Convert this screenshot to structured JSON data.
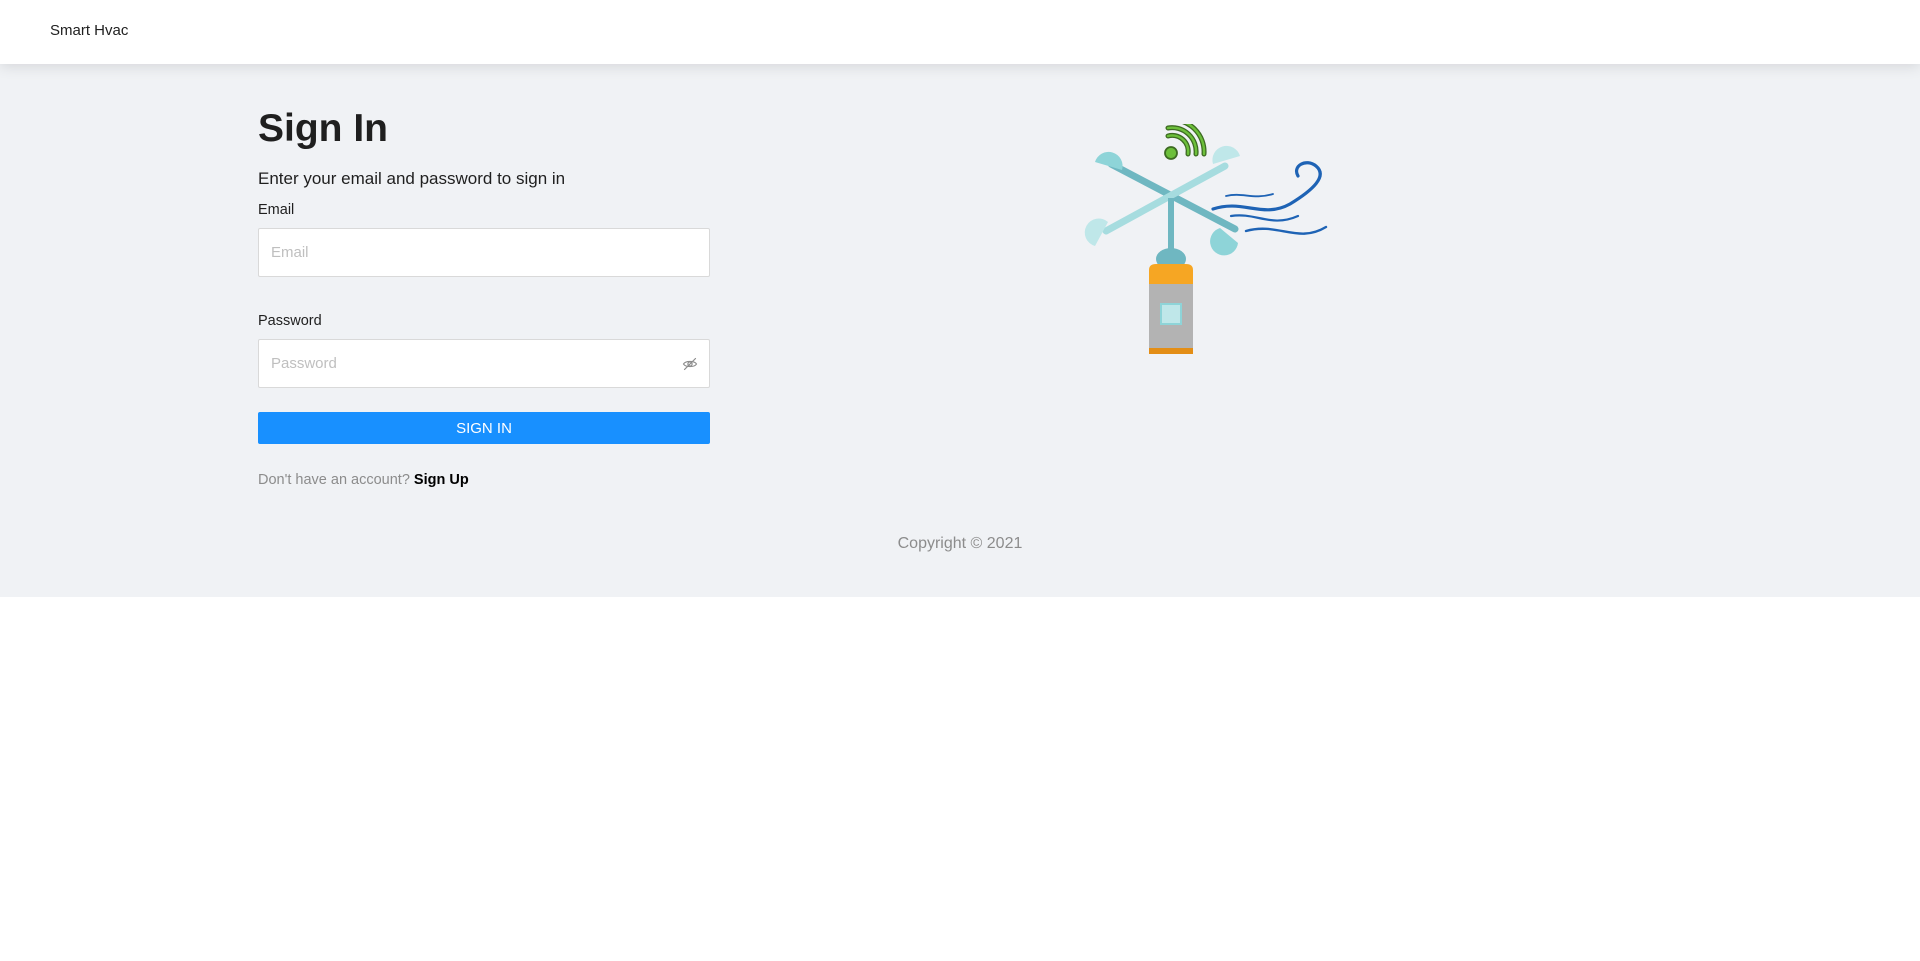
{
  "navbar": {
    "brand": "Smart Hvac"
  },
  "signin": {
    "title": "Sign In",
    "subtitle": "Enter your email and password to sign in",
    "email_label": "Email",
    "email_placeholder": "Email",
    "email_value": "",
    "password_label": "Password",
    "password_placeholder": "Password",
    "password_value": "",
    "password_toggle_icon": "eye-invisible-icon",
    "submit_label": "SIGN IN",
    "signup_prompt": "Don't have an account?",
    "signup_link": "Sign Up"
  },
  "illustration": {
    "icon": "anemometer-wind-sensor-icon"
  },
  "footer": {
    "copyright": "Copyright © 2021"
  },
  "colors": {
    "primary": "#1890ff",
    "content_background": "#f0f2f5",
    "navbar_background": "#ffffff"
  }
}
